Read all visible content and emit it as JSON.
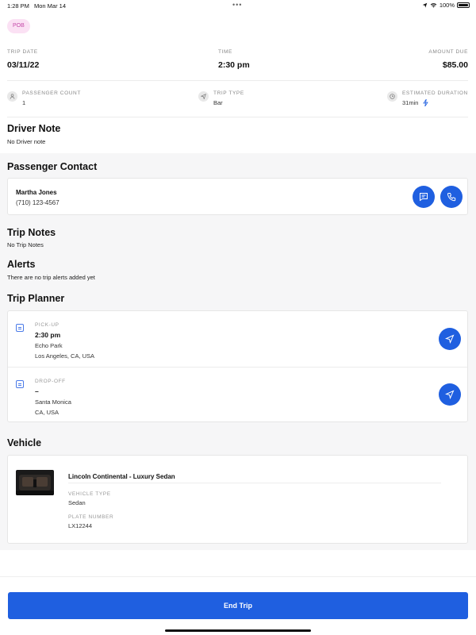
{
  "status_bar": {
    "time": "1:28 PM",
    "date": "Mon Mar 14",
    "battery": "100%"
  },
  "badge": "POB",
  "summary": {
    "trip_date_label": "TRIP DATE",
    "trip_date": "03/11/22",
    "time_label": "TIME",
    "time": "2:30 pm",
    "amount_label": "AMOUNT DUE",
    "amount": "$85.00"
  },
  "meta": {
    "passenger_count_label": "PASSENGER COUNT",
    "passenger_count": "1",
    "trip_type_label": "TRIP TYPE",
    "trip_type": "Bar",
    "duration_label": "ESTIMATED DURATION",
    "duration": "31min"
  },
  "driver_note": {
    "title": "Driver Note",
    "text": "No Driver note"
  },
  "passenger_contact": {
    "title": "Passenger Contact",
    "name": "Martha Jones",
    "phone": "(710) 123-4567"
  },
  "trip_notes": {
    "title": "Trip Notes",
    "text": "No Trip Notes"
  },
  "alerts": {
    "title": "Alerts",
    "text": "There are no trip alerts added yet"
  },
  "trip_planner": {
    "title": "Trip Planner",
    "pickup": {
      "label": "PICK-UP",
      "time": "2:30 pm",
      "line1": "Echo Park",
      "line2": "Los Angeles, CA, USA"
    },
    "dropoff": {
      "label": "DROP-OFF",
      "time": "–",
      "line1": "Santa Monica",
      "line2": "CA, USA"
    }
  },
  "vehicle": {
    "title": "Vehicle",
    "name": "Lincoln Continental - Luxury Sedan",
    "type_label": "VEHICLE TYPE",
    "type": "Sedan",
    "plate_label": "PLATE NUMBER",
    "plate": "LX12244"
  },
  "end_trip_label": "End Trip",
  "colors": {
    "accent": "#1f5fe0",
    "badge_bg": "#fbe1f4",
    "badge_text": "#c44aa8",
    "band": "#f6f6f7"
  }
}
